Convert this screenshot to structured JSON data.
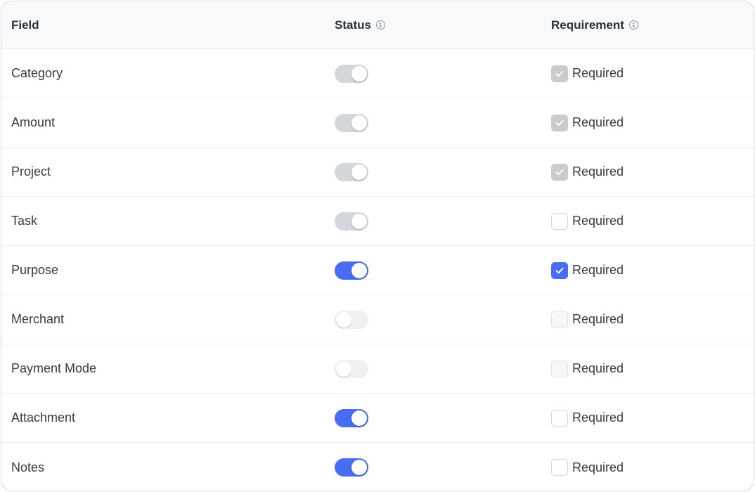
{
  "header": {
    "field": "Field",
    "status": "Status",
    "requirement": "Requirement",
    "status_info_icon": "info-icon",
    "requirement_info_icon": "info-icon"
  },
  "colors": {
    "accent": "#4a6cf0",
    "disabled_toggle": "#d3d6db",
    "off_toggle": "#eef0f2",
    "disabled_checkbox": "#c9cbcf"
  },
  "rows": [
    {
      "field": "Category",
      "status": "on-disabled",
      "required": "checked-disabled",
      "required_label": "Required"
    },
    {
      "field": "Amount",
      "status": "on-disabled",
      "required": "checked-disabled",
      "required_label": "Required"
    },
    {
      "field": "Project",
      "status": "on-disabled",
      "required": "checked-disabled",
      "required_label": "Required"
    },
    {
      "field": "Task",
      "status": "on-disabled",
      "required": "unchecked",
      "required_label": "Required"
    },
    {
      "field": "Purpose",
      "status": "on",
      "required": "checked",
      "required_label": "Required"
    },
    {
      "field": "Merchant",
      "status": "off",
      "required": "unchecked-disabled",
      "required_label": "Required"
    },
    {
      "field": "Payment Mode",
      "status": "off",
      "required": "unchecked-disabled",
      "required_label": "Required"
    },
    {
      "field": "Attachment",
      "status": "on",
      "required": "unchecked",
      "required_label": "Required"
    },
    {
      "field": "Notes",
      "status": "on",
      "required": "unchecked",
      "required_label": "Required"
    }
  ]
}
